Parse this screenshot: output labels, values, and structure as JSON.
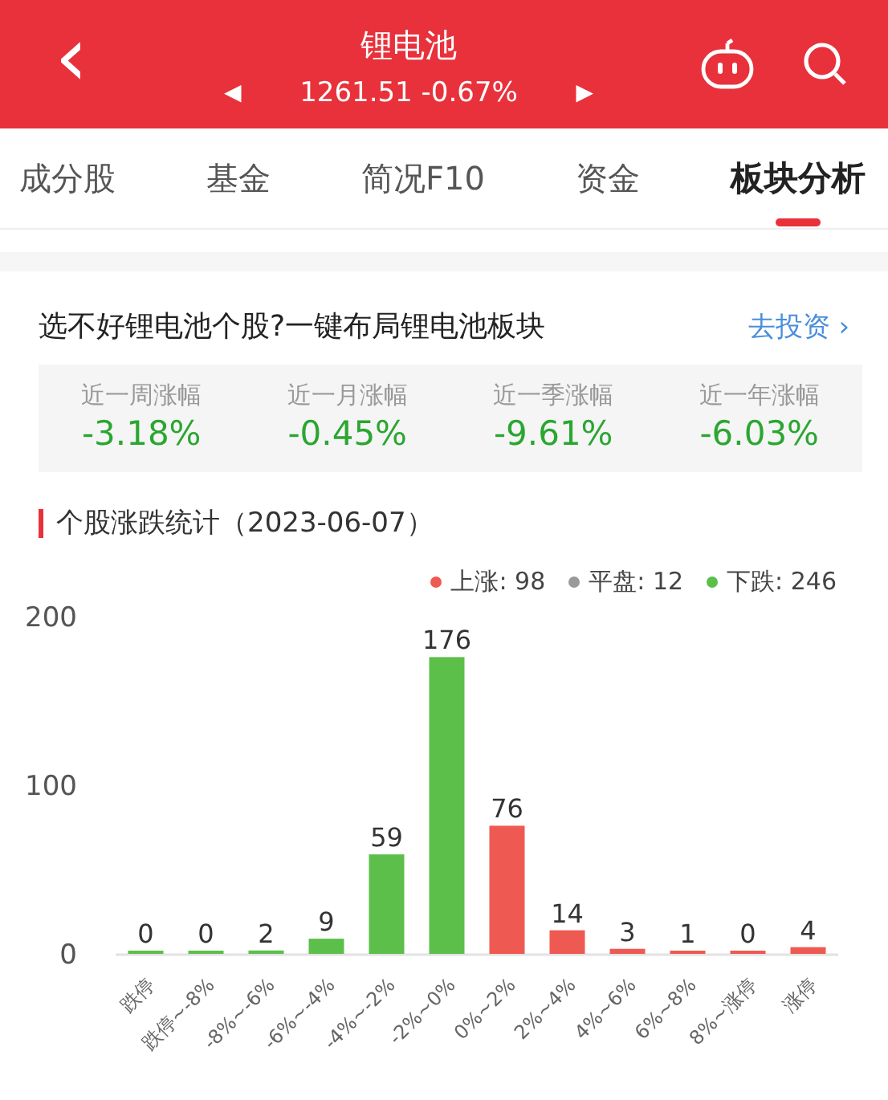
{
  "header": {
    "back": "‹",
    "prev": "◀",
    "next": "▶",
    "title": "锂电池",
    "quote": "1261.51 -0.67%"
  },
  "tabs": [
    {
      "label": "成分股",
      "selected": false
    },
    {
      "label": "基金",
      "selected": false
    },
    {
      "label": "简况F10",
      "selected": false
    },
    {
      "label": "资金",
      "selected": false
    },
    {
      "label": "板块分析",
      "selected": true
    }
  ],
  "promo": {
    "text": "选不好锂电池个股?一键布局锂电池板块",
    "link": "去投资",
    "arrow": "›"
  },
  "stats": [
    {
      "label": "近一周涨幅",
      "value": "-3.18%"
    },
    {
      "label": "近一月涨幅",
      "value": "-0.45%"
    },
    {
      "label": "近一季涨幅",
      "value": "-9.61%"
    },
    {
      "label": "近一年涨幅",
      "value": "-6.03%"
    }
  ],
  "section_title": "个股涨跌统计（2023-06-07）",
  "legend": [
    {
      "label": "上涨: 98",
      "color": "#ee5a52"
    },
    {
      "label": "平盘: 12",
      "color": "#999999"
    },
    {
      "label": "下跌: 246",
      "color": "#5cbf4a"
    }
  ],
  "chart_data": {
    "type": "bar",
    "categories": [
      "跌停",
      "跌停~-8%",
      "-8%~-6%",
      "-6%~-4%",
      "-4%~-2%",
      "-2%~0%",
      "0%~2%",
      "2%~4%",
      "4%~6%",
      "6%~8%",
      "8%~涨停",
      "涨停"
    ],
    "series": [
      {
        "color": "#5cbf4a",
        "values": [
          0,
          0,
          2,
          9,
          59,
          176,
          null,
          null,
          null,
          null,
          null,
          null
        ]
      },
      {
        "color": "#ee5a52",
        "values": [
          null,
          null,
          null,
          null,
          null,
          null,
          76,
          14,
          3,
          1,
          0,
          4
        ]
      }
    ],
    "ylim": [
      0,
      200
    ],
    "yticks": [
      0,
      100,
      200
    ],
    "data_labels": true
  }
}
